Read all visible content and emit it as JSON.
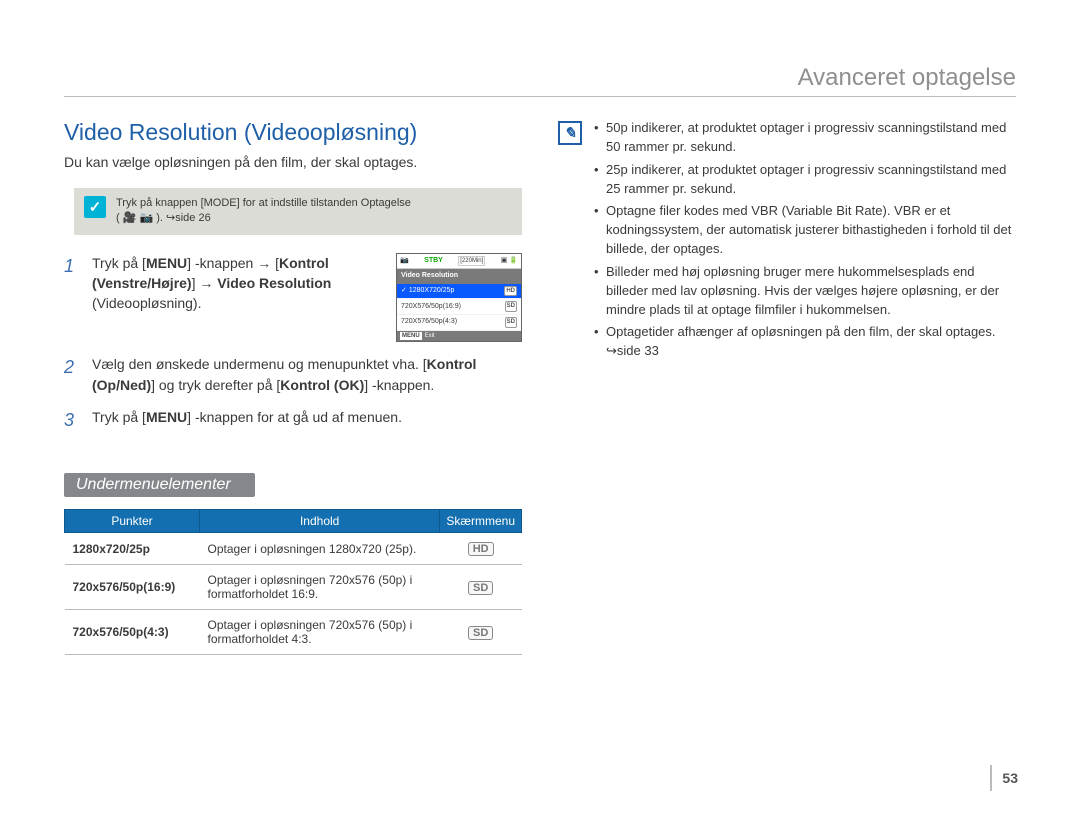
{
  "section_title": "Avanceret optagelse",
  "heading": "Video Resolution (Videoopløsning)",
  "intro": "Du kan vælge opløsningen på den film, der skal optages.",
  "precheck": {
    "line": "Tryk på knappen [MODE] for at indstille tilstanden Optagelse",
    "line2": "( 🎥 📷 ). ↪side 26"
  },
  "steps": [
    {
      "parts": {
        "a": "Tryk på [",
        "b": "MENU",
        "c": "] -knappen → [",
        "d": "Kontrol (Venstre/Højre)",
        "e": "] → ",
        "f": "Video Resolution",
        "g": " (Videoopløsning)."
      }
    },
    {
      "parts": {
        "a": "Vælg den ønskede undermenu og menupunktet vha. [",
        "b": "Kontrol (Op/Ned)",
        "c": "] og tryk derefter på [",
        "d": "Kontrol (OK)",
        "e": "] -knappen."
      }
    },
    {
      "parts": {
        "a": "Tryk på [",
        "b": "MENU",
        "c": "] -knappen for at gå ud af menuen."
      }
    }
  ],
  "cam": {
    "stby": "STBY",
    "time": "[220Min]",
    "header": "Video Resolution",
    "rows": [
      {
        "label": "1280X720/25p",
        "badge": "HD",
        "selected": true
      },
      {
        "label": "720X576/50p(16:9)",
        "badge": "SD",
        "selected": false
      },
      {
        "label": "720X576/50p(4:3)",
        "badge": "SD",
        "selected": false
      }
    ],
    "exit_label": "MENU",
    "exit_text": "Exit"
  },
  "submenu_heading": "Undermenuelementer",
  "table": {
    "headers": {
      "punkt": "Punkter",
      "indhold": "Indhold",
      "skarm": "Skærmmenu"
    },
    "rows": [
      {
        "punkt": "1280x720/25p",
        "indhold": "Optager i opløsningen 1280x720 (25p).",
        "badge": "HD"
      },
      {
        "punkt": "720x576/50p(16:9)",
        "indhold": "Optager i opløsningen 720x576 (50p) i formatforholdet 16:9.",
        "badge": "SD"
      },
      {
        "punkt": "720x576/50p(4:3)",
        "indhold": "Optager i opløsningen 720x576 (50p) i formatforholdet 4:3.",
        "badge": "SD"
      }
    ]
  },
  "notes": [
    "50p indikerer, at produktet optager i progressiv scanningstilstand med 50 rammer pr. sekund.",
    "25p indikerer, at produktet optager i progressiv scanningstilstand med 25 rammer pr. sekund.",
    "Optagne filer kodes med VBR (Variable Bit Rate). VBR er et kodningssystem, der automatisk justerer bithastigheden i forhold til det billede, der optages.",
    "Billeder med høj opløsning bruger mere hukommelsesplads end billeder med lav opløsning. Hvis der vælges højere opløsning, er der mindre plads til at optage filmfiler i hukommelsen.",
    "Optagetider afhænger af opløsningen på den film, der skal optages. ↪side 33"
  ],
  "page_number": "53"
}
